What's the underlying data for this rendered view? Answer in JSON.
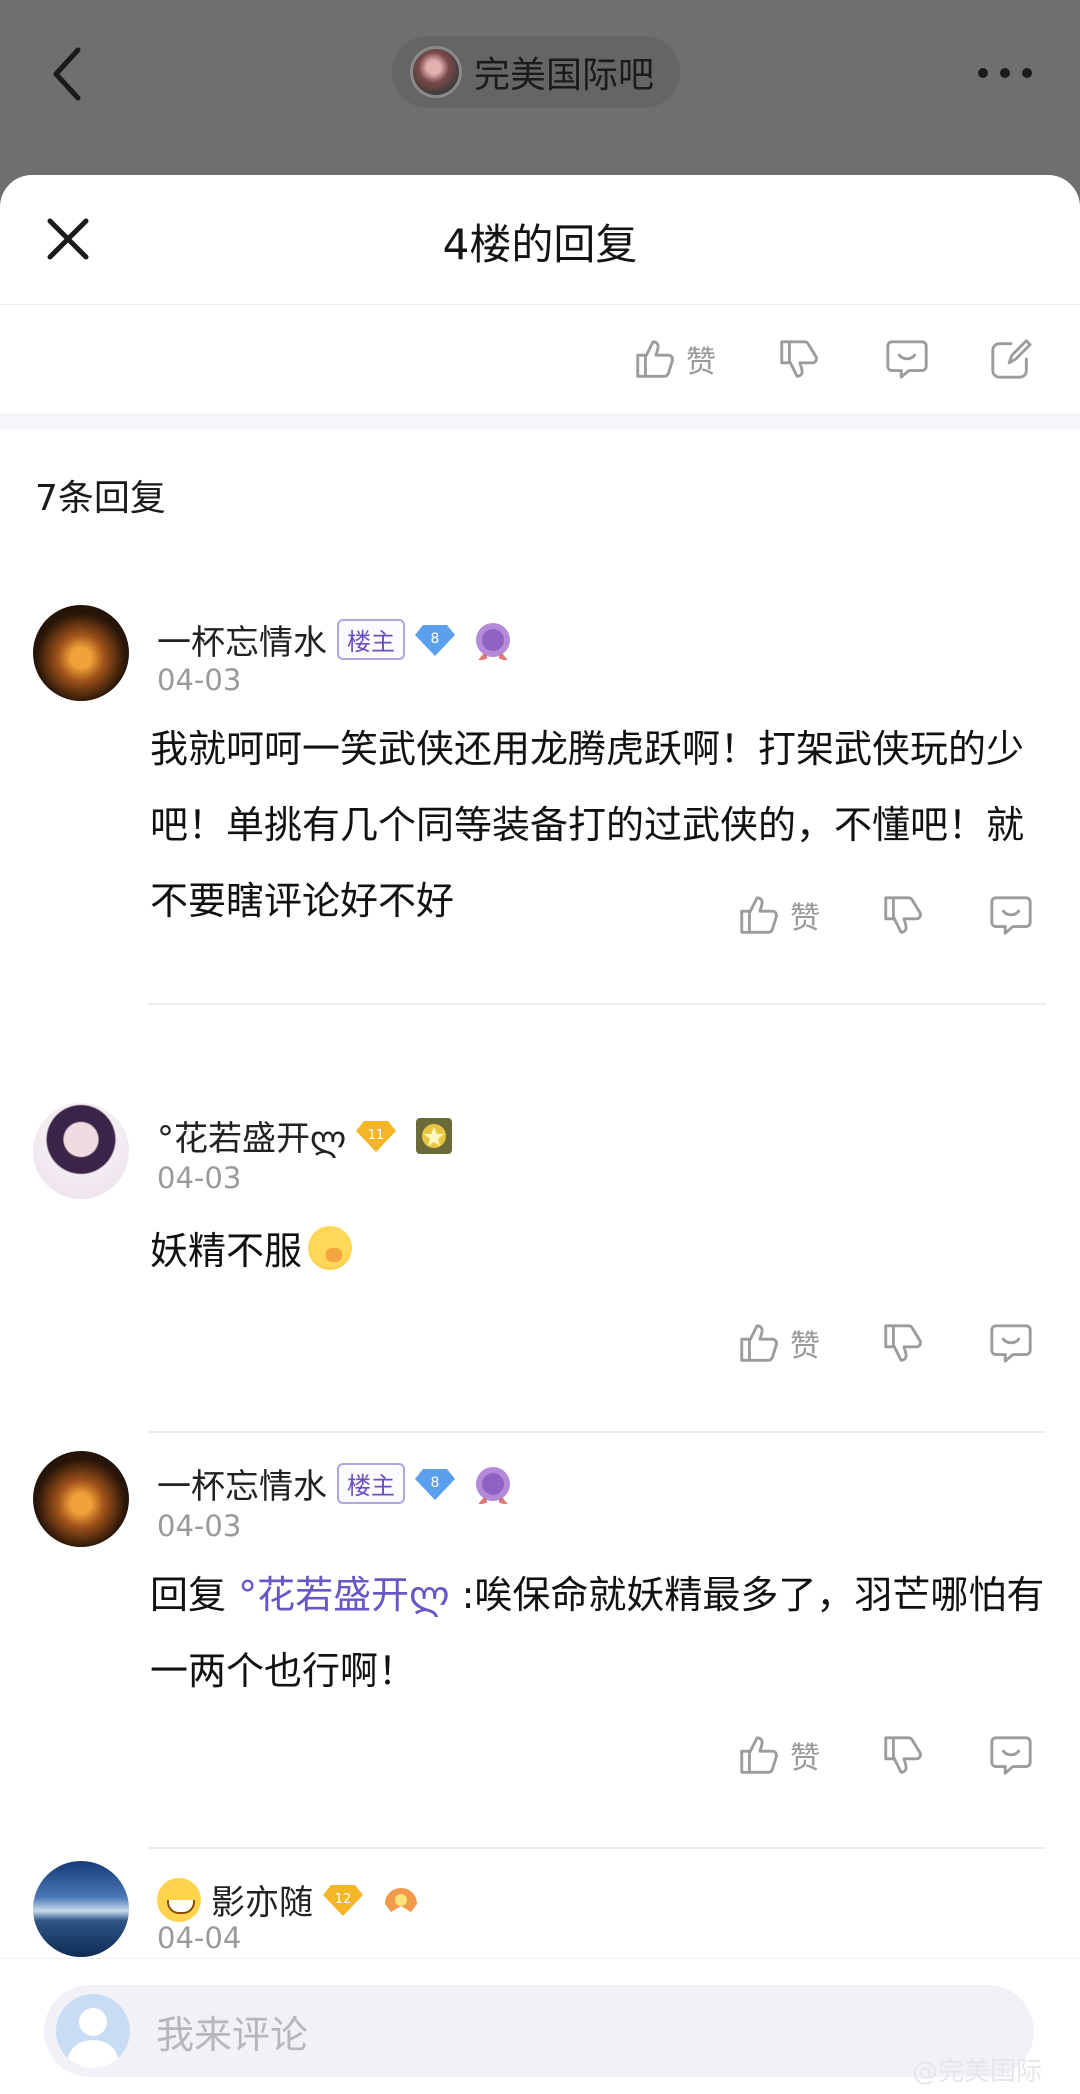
{
  "header": {
    "forum_name": "完美国际吧"
  },
  "sheet": {
    "title": "4楼的回复"
  },
  "post_actions": {
    "like_label": "赞"
  },
  "reply_count": "7条回复",
  "comments": [
    {
      "username": "一杯忘情水",
      "owner_badge": "楼主",
      "level": "8",
      "date": "04-03",
      "text": "我就呵呵一笑武侠还用龙腾虎跃啊！打架武侠玩的少吧！单挑有几个同等装备打的过武侠的，不懂吧！就不要瞎评论好不好",
      "like_label": "赞"
    },
    {
      "username": "°花若盛开ლ",
      "level": "11",
      "date": "04-03",
      "text": "妖精不服",
      "like_label": "赞"
    },
    {
      "username": "一杯忘情水",
      "owner_badge": "楼主",
      "level": "8",
      "date": "04-03",
      "reply_prefix": "回复 ",
      "mention": "°花若盛开ლ",
      "text": " :唉保命就妖精最多了，羽芒哪怕有一两个也行啊！",
      "like_label": "赞"
    },
    {
      "username": "影亦随",
      "level": "12",
      "date": "04-04"
    }
  ],
  "input": {
    "placeholder": "我来评论"
  },
  "watermark": "@完美国际",
  "colors": {
    "accent": "#6a56c4",
    "icon_gray": "#9c9c9c"
  }
}
